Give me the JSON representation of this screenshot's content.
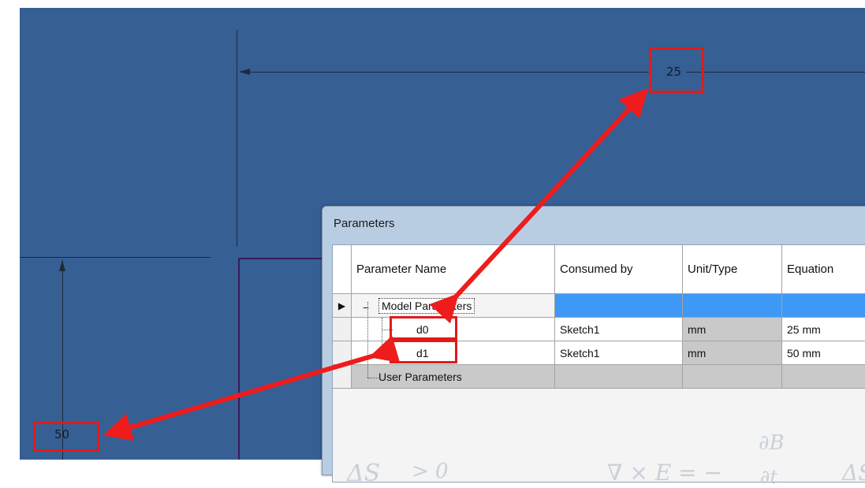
{
  "canvas": {
    "dim_horizontal": "25",
    "dim_vertical": "50"
  },
  "dialog": {
    "title": "Parameters",
    "columns": [
      "Parameter Name",
      "Consumed by",
      "Unit/Type",
      "Equation"
    ],
    "rows": [
      {
        "name": "Model Parameters",
        "consumed_by": "",
        "unit": "",
        "equation": ""
      },
      {
        "name": "d0",
        "consumed_by": "Sketch1",
        "unit": "mm",
        "equation": "25 mm"
      },
      {
        "name": "d1",
        "consumed_by": "Sketch1",
        "unit": "mm",
        "equation": "50 mm"
      },
      {
        "name": "User Parameters",
        "consumed_by": "",
        "unit": "",
        "equation": ""
      }
    ],
    "background_formulas": [
      "ΔS",
      "> 0",
      "∇ × E = −",
      "∂B",
      "∂t"
    ]
  },
  "colors": {
    "canvas": "#365f94",
    "callout": "#e01b1b",
    "selected_row": "#3d99f5"
  }
}
